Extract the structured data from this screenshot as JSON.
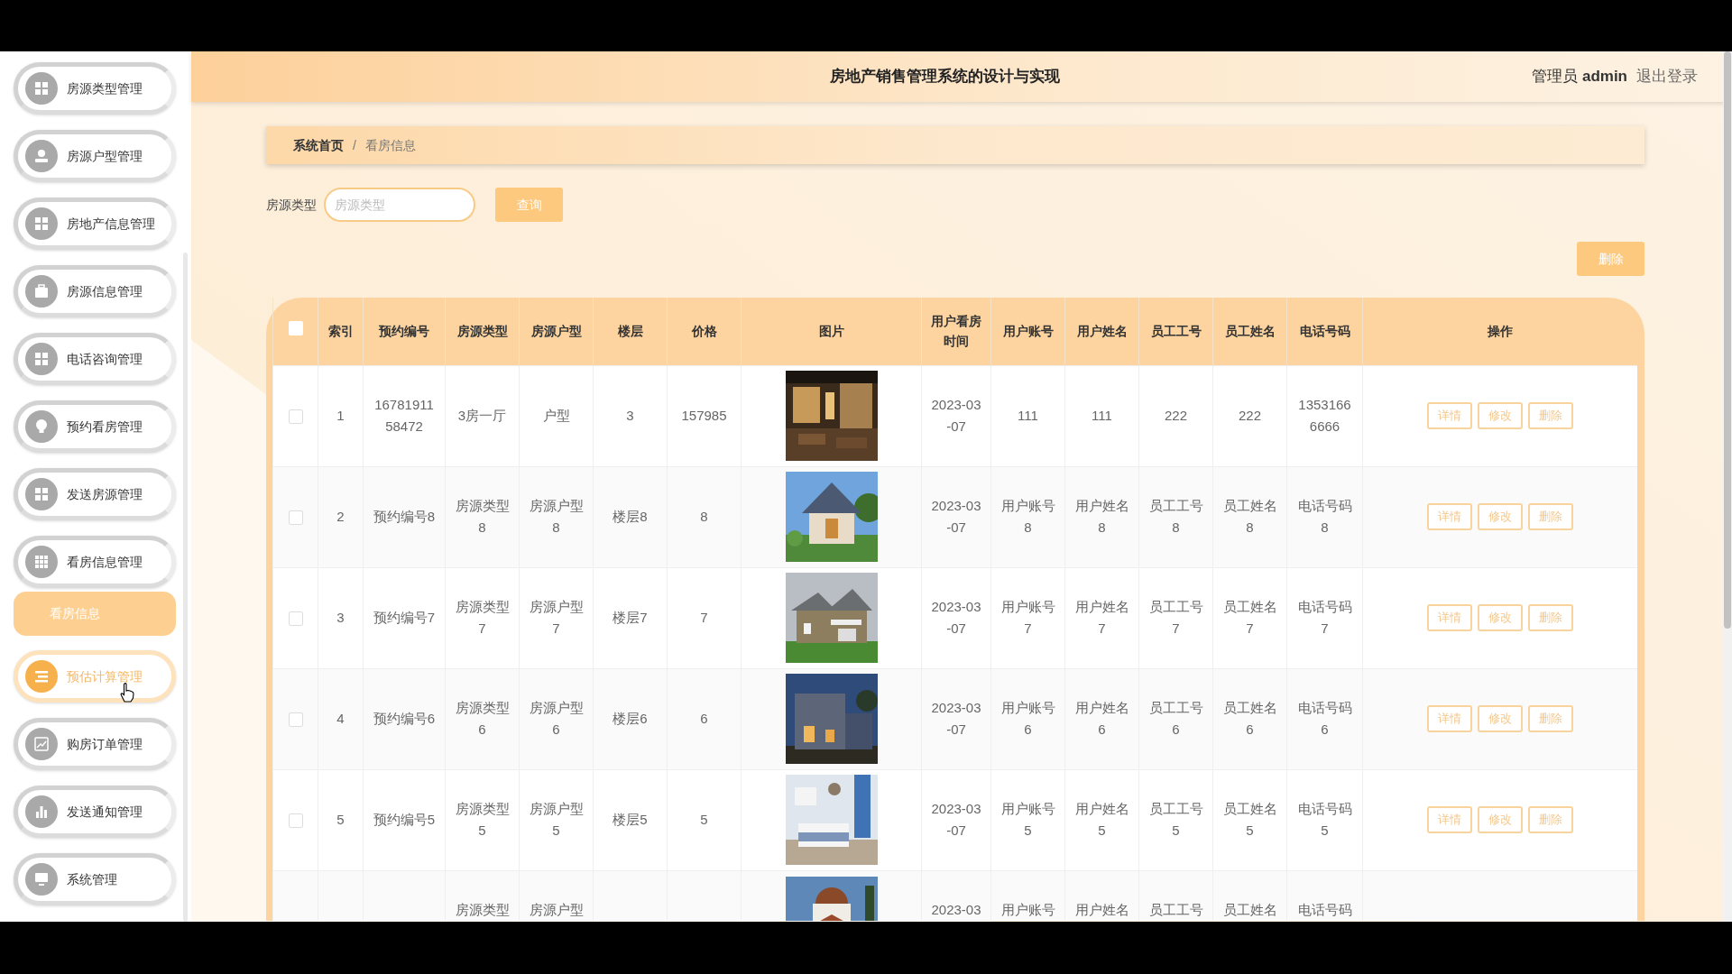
{
  "header": {
    "title": "房地产销售管理系统的设计与实现",
    "user_role": "管理员",
    "username": "admin",
    "logout": "退出登录"
  },
  "sidebar": {
    "items": [
      {
        "label": "房源类型管理",
        "kind": "menu",
        "hovered": false
      },
      {
        "label": "房源户型管理",
        "kind": "menu",
        "hovered": false
      },
      {
        "label": "房地产信息管理",
        "kind": "menu",
        "hovered": false
      },
      {
        "label": "房源信息管理",
        "kind": "menu",
        "hovered": false
      },
      {
        "label": "电话咨询管理",
        "kind": "menu",
        "hovered": false
      },
      {
        "label": "预约看房管理",
        "kind": "menu",
        "hovered": false
      },
      {
        "label": "发送房源管理",
        "kind": "menu",
        "hovered": false
      },
      {
        "label": "看房信息管理",
        "kind": "menu",
        "hovered": false
      },
      {
        "label": "看房信息",
        "kind": "submenu",
        "selected": true
      },
      {
        "label": "预估计算管理",
        "kind": "menu",
        "hovered": true
      },
      {
        "label": "购房订单管理",
        "kind": "menu",
        "hovered": false
      },
      {
        "label": "发送通知管理",
        "kind": "menu",
        "hovered": false
      },
      {
        "label": "系统管理",
        "kind": "menu",
        "hovered": false
      }
    ]
  },
  "breadcrumb": {
    "items": [
      "系统首页",
      "看房信息"
    ],
    "separator": "/"
  },
  "search": {
    "label": "房源类型",
    "placeholder": "房源类型",
    "button": "查询"
  },
  "delete_button": "删除",
  "table": {
    "select_all_checked": false,
    "columns": [
      "索引",
      "预约编号",
      "房源类型",
      "房源户型",
      "楼层",
      "价格",
      "图片",
      "用户看房时间",
      "用户账号",
      "用户姓名",
      "员工工号",
      "员工姓名",
      "电话号码",
      "操作"
    ],
    "rows": [
      {
        "checked": false,
        "cells": [
          "1",
          "1678191158472",
          "3房一厅",
          "户型",
          "3",
          "157985",
          "",
          "2023-03-07",
          "111",
          "111",
          "222",
          "222",
          "13531666666"
        ],
        "actions": [
          "详情",
          "修改",
          "删除"
        ]
      },
      {
        "checked": false,
        "cells": [
          "2",
          "预约编号8",
          "房源类型8",
          "房源户型8",
          "楼层8",
          "8",
          "",
          "2023-03-07",
          "用户账号8",
          "用户姓名8",
          "员工工号8",
          "员工姓名8",
          "电话号码8"
        ],
        "actions": [
          "详情",
          "修改",
          "删除"
        ]
      },
      {
        "checked": false,
        "cells": [
          "3",
          "预约编号7",
          "房源类型7",
          "房源户型7",
          "楼层7",
          "7",
          "",
          "2023-03-07",
          "用户账号7",
          "用户姓名7",
          "员工工号7",
          "员工姓名7",
          "电话号码7"
        ],
        "actions": [
          "详情",
          "修改",
          "删除"
        ]
      },
      {
        "checked": false,
        "cells": [
          "4",
          "预约编号6",
          "房源类型6",
          "房源户型6",
          "楼层6",
          "6",
          "",
          "2023-03-07",
          "用户账号6",
          "用户姓名6",
          "员工工号6",
          "员工姓名6",
          "电话号码6"
        ],
        "actions": [
          "详情",
          "修改",
          "删除"
        ]
      },
      {
        "checked": false,
        "cells": [
          "5",
          "预约编号5",
          "房源类型5",
          "房源户型5",
          "楼层5",
          "5",
          "",
          "2023-03-07",
          "用户账号5",
          "用户姓名5",
          "员工工号5",
          "员工姓名5",
          "电话号码5"
        ],
        "actions": [
          "详情",
          "修改",
          "删除"
        ]
      },
      {
        "cells": [
          null,
          null,
          "房源类型",
          "房源户型",
          null,
          null,
          "",
          "2023-03",
          "用户账号",
          "用户姓名",
          "员工工号",
          "员工姓名",
          "电话号码"
        ]
      }
    ]
  }
}
